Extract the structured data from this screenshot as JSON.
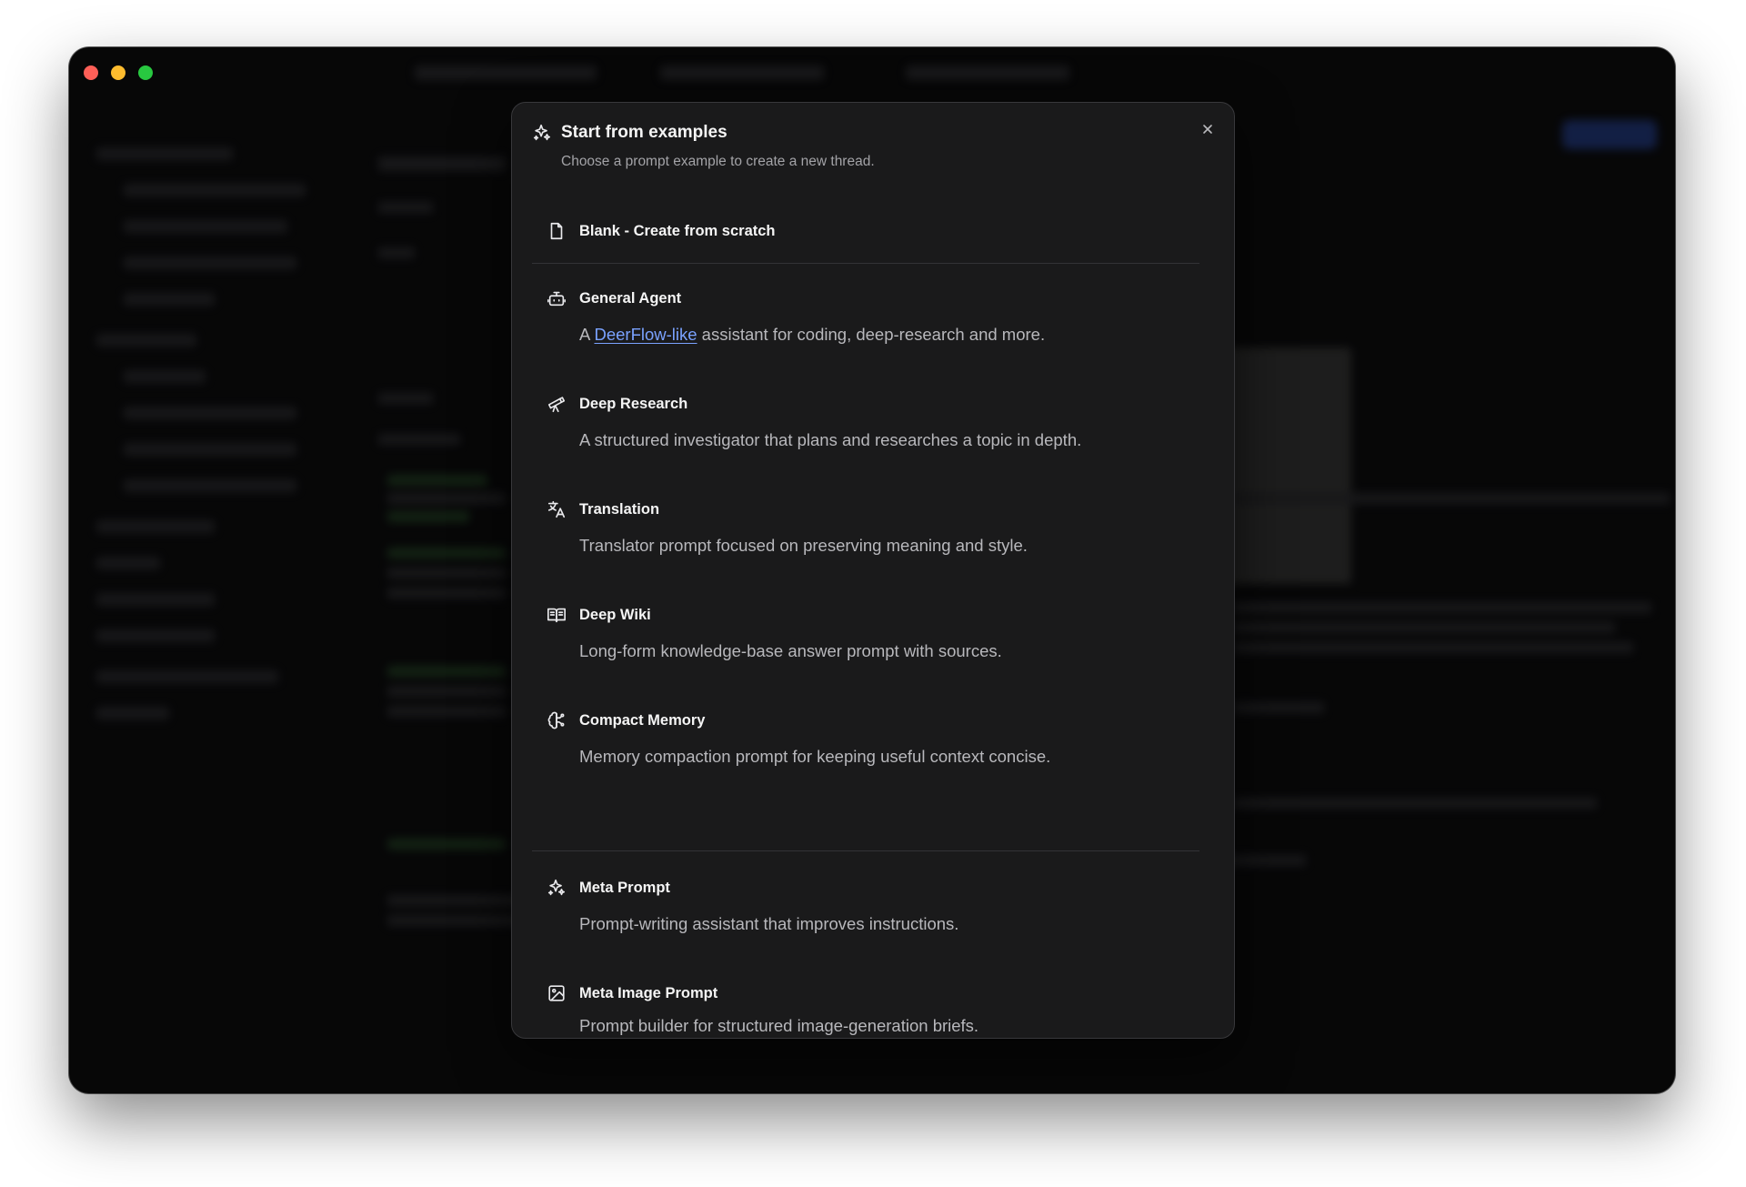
{
  "modal": {
    "title": "Start from examples",
    "subtitle": "Choose a prompt example to create a new thread.",
    "close_icon": "close-icon",
    "blank": {
      "title": "Blank - Create from scratch",
      "icon": "file-icon"
    },
    "examples": [
      {
        "title": "General Agent",
        "icon": "bot-icon",
        "desc_prefix": "A ",
        "desc_link": "DeerFlow-like",
        "desc_suffix": " assistant for coding, deep-research and more."
      },
      {
        "title": "Deep Research",
        "icon": "telescope-icon",
        "desc": "A structured investigator that plans and researches a topic in depth."
      },
      {
        "title": "Translation",
        "icon": "translate-icon",
        "desc": "Translator prompt focused on preserving meaning and style."
      },
      {
        "title": "Deep Wiki",
        "icon": "book-open-icon",
        "desc": "Long-form knowledge-base answer prompt with sources."
      },
      {
        "title": "Compact Memory",
        "icon": "brain-icon",
        "desc": "Memory compaction prompt for keeping useful context concise."
      }
    ],
    "meta": [
      {
        "title": "Meta Prompt",
        "icon": "sparkles-icon",
        "desc": "Prompt-writing assistant that improves instructions."
      },
      {
        "title": "Meta Image Prompt",
        "icon": "image-icon",
        "desc": "Prompt builder for structured image-generation briefs."
      }
    ]
  },
  "colors": {
    "accent_link": "#7aa2ff",
    "modal_bg": "#1a1a1b",
    "window_bg": "#0b0b0c"
  }
}
